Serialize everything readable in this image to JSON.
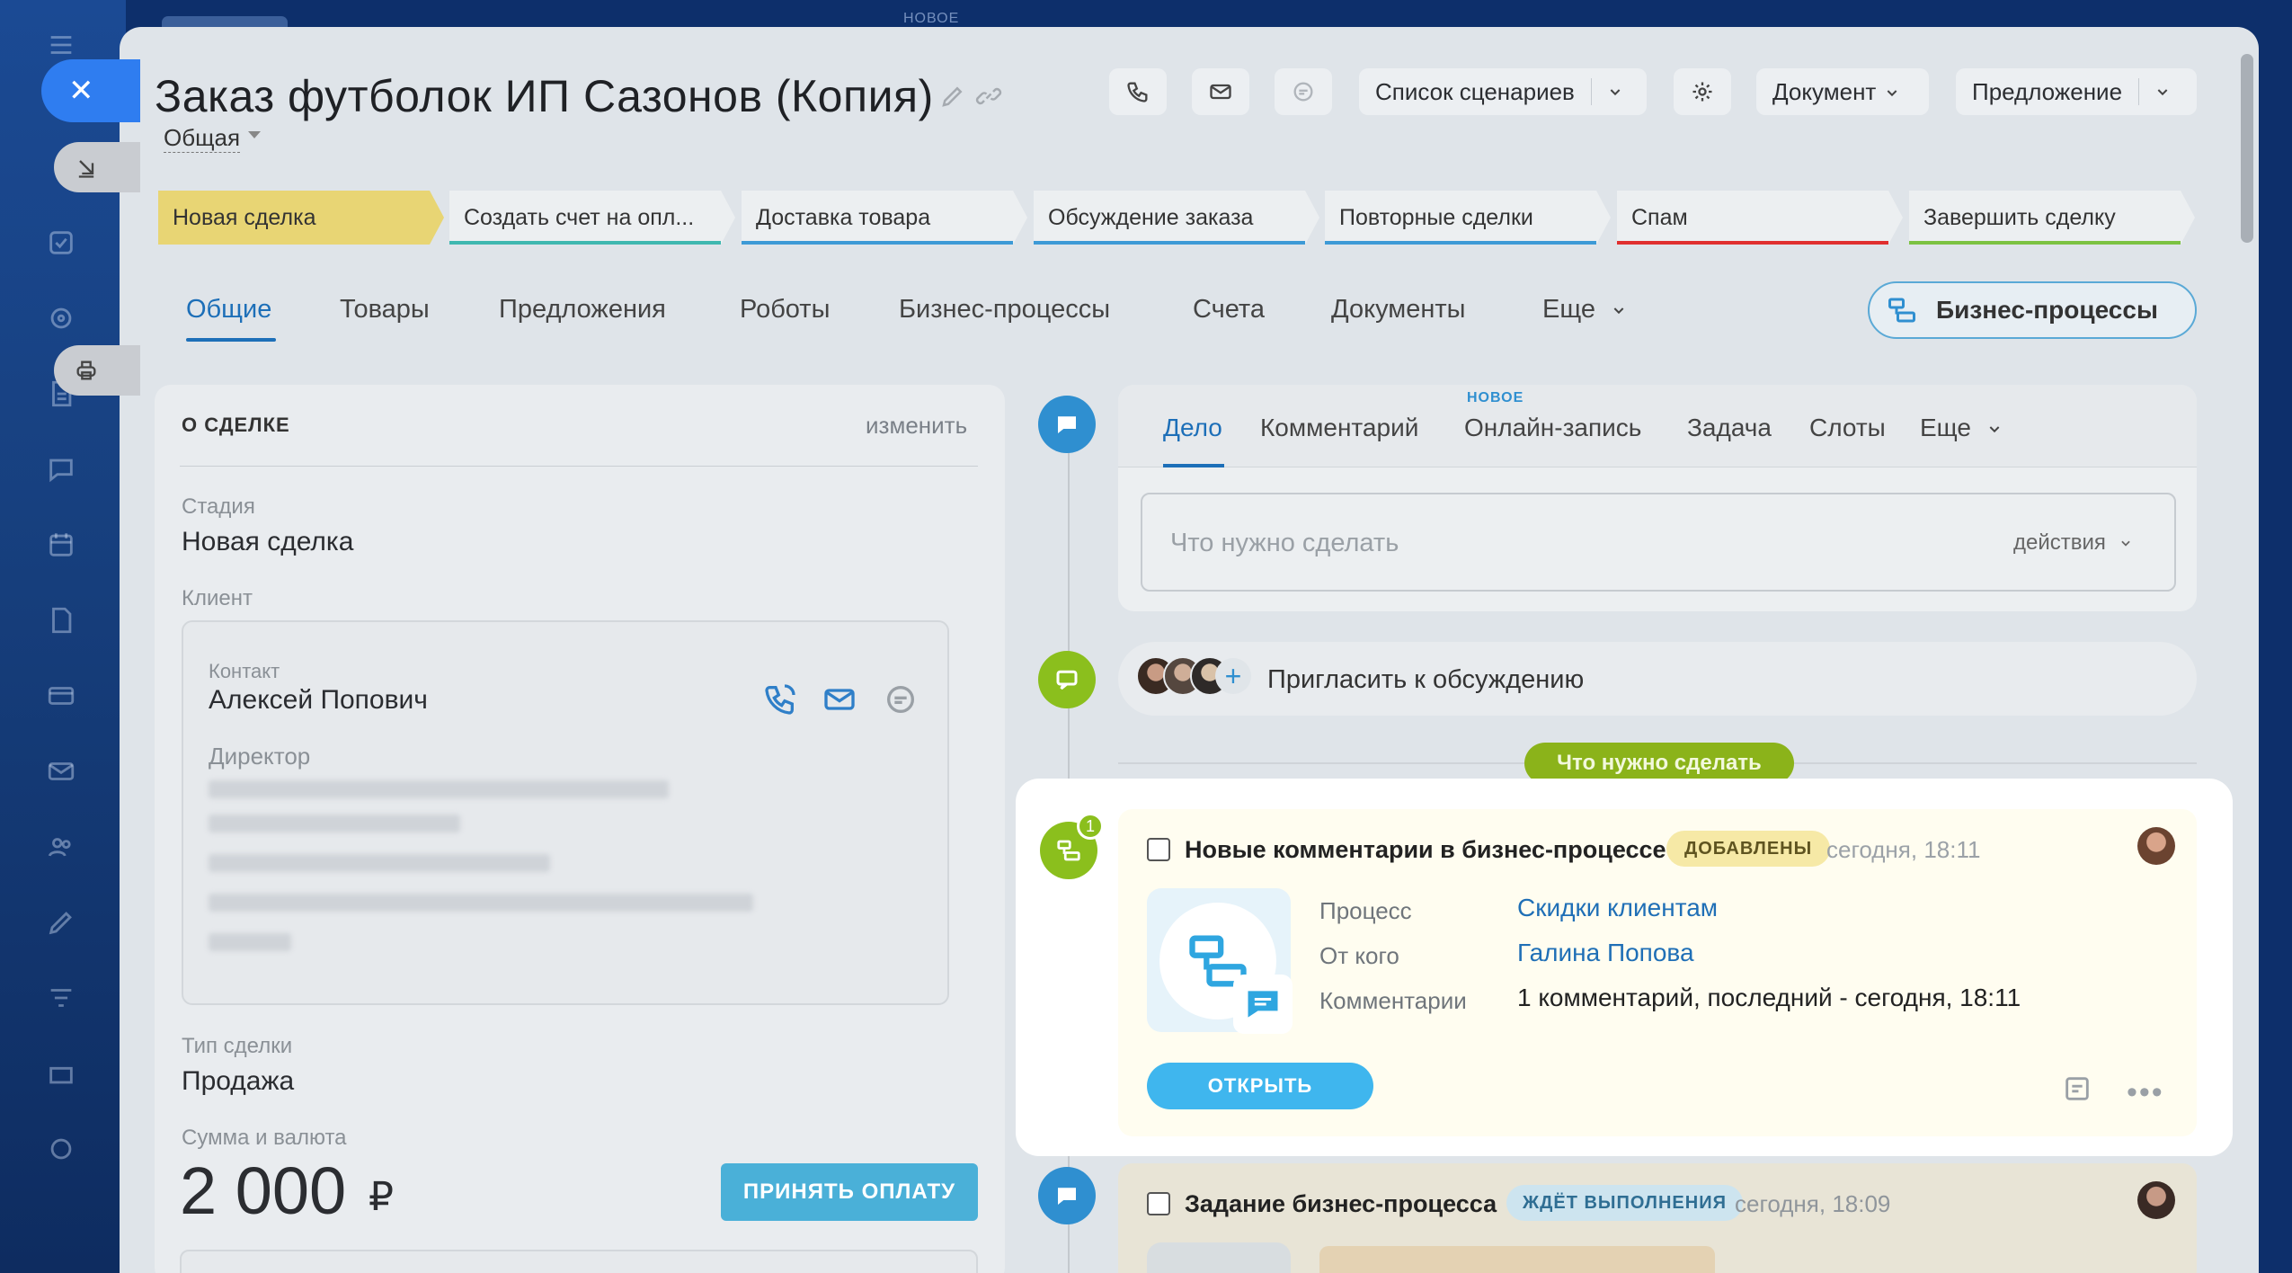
{
  "window": {
    "top_badge": "НОВОЕ"
  },
  "header": {
    "title": "Заказ футболок ИП Сазонов (Копия)",
    "category": "Общая",
    "scenarios_label": "Список сценариев",
    "document_label": "Документ",
    "offer_label": "Предложение"
  },
  "stages": [
    {
      "label": "Новая сделка",
      "color": "#e8d574"
    },
    {
      "label": "Создать счет на опл...",
      "color": "#3fb8b0"
    },
    {
      "label": "Доставка товара",
      "color": "#3d9ad6"
    },
    {
      "label": "Обсуждение заказа",
      "color": "#3d9ad6"
    },
    {
      "label": "Повторные сделки",
      "color": "#3d9ad6"
    },
    {
      "label": "Спам",
      "color": "#e02f2f"
    },
    {
      "label": "Завершить сделку",
      "color": "#7cc242"
    }
  ],
  "tabs": [
    "Общие",
    "Товары",
    "Предложения",
    "Роботы",
    "Бизнес-процессы",
    "Счета",
    "Документы",
    "Еще"
  ],
  "bp_button": "Бизнес-процессы",
  "deal": {
    "heading": "О СДЕЛКЕ",
    "edit": "изменить",
    "stage_label": "Стадия",
    "stage_value": "Новая сделка",
    "client_label": "Клиент",
    "contact_label": "Контакт",
    "contact_name": "Алексей Попович",
    "contact_post": "Директор",
    "type_label": "Тип сделки",
    "type_value": "Продажа",
    "amount_label": "Сумма и валюта",
    "amount": "2 000",
    "currency": "₽",
    "pay_button": "ПРИНЯТЬ ОПЛАТУ"
  },
  "editor": {
    "tabs": [
      "Дело",
      "Комментарий",
      "Онлайн-запись",
      "Задача",
      "Слоты",
      "Еще"
    ],
    "new_tag": "НОВОЕ",
    "placeholder": "Что нужно сделать",
    "actions": "действия"
  },
  "invite": {
    "text": "Пригласить к обсуждению",
    "plus": "+"
  },
  "todo_pill": "Что нужно сделать",
  "activity": {
    "badge_count": "1",
    "title": "Новые комментарии в бизнес-процессе",
    "status": "ДОБАВЛЕНЫ",
    "time": "сегодня, 18:11",
    "rows": [
      {
        "key": "Процесс",
        "value": "Скидки клиентам"
      },
      {
        "key": "От кого",
        "value": "Галина Попова"
      },
      {
        "key": "Комментарии",
        "value": "1 комментарий, последний - сегодня, 18:11"
      }
    ],
    "open_button": "ОТКРЫТЬ",
    "more": "•••"
  },
  "next_activity": {
    "title": "Задание бизнес-процесса",
    "status": "ЖДЁТ ВЫПОЛНЕНИЯ",
    "time": "сегодня, 18:09"
  }
}
